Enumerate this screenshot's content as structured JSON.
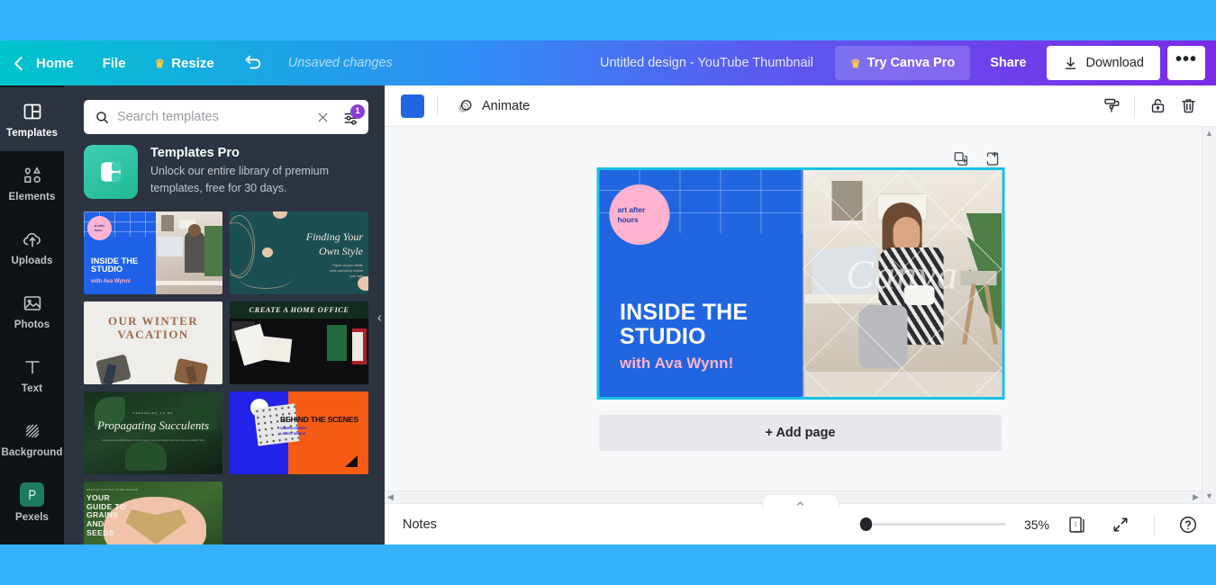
{
  "window": {
    "chrome_color": "#35B2FB"
  },
  "topbar": {
    "back_label": "Home",
    "file_label": "File",
    "resize_label": "Resize",
    "undo_icon": "undo-icon",
    "unsaved_label": "Unsaved changes",
    "doc_title": "Untitled design - YouTube Thumbnail",
    "try_pro_label": "Try Canva Pro",
    "share_label": "Share",
    "download_label": "Download",
    "more_label": "•••",
    "crown_icon": "crown-icon"
  },
  "rail": {
    "items": [
      {
        "label": "Templates",
        "icon": "templates-icon",
        "active": true
      },
      {
        "label": "Elements",
        "icon": "elements-icon",
        "active": false
      },
      {
        "label": "Uploads",
        "icon": "uploads-cloud-icon",
        "active": false
      },
      {
        "label": "Photos",
        "icon": "photos-image-icon",
        "active": false
      },
      {
        "label": "Text",
        "icon": "text-t-icon",
        "active": false
      },
      {
        "label": "Background",
        "icon": "background-hatch-icon",
        "active": false
      },
      {
        "label": "Pexels",
        "icon": "pexels-app-icon",
        "active": false
      }
    ]
  },
  "panel": {
    "search": {
      "placeholder": "Search templates",
      "value": "",
      "clear_icon": "close-icon",
      "filter_icon": "filter-sliders-icon",
      "filter_badge": "1"
    },
    "promo": {
      "title": "Templates Pro",
      "subtitle": "Unlock our entire library of premium templates, free for 30 days.",
      "icon": "templates-pro-icon"
    },
    "templates": [
      {
        "name": "Inside the Studio",
        "title": "INSIDE THE STUDIO",
        "subtitle": "with Ava Wynn!",
        "badge": "art after hours",
        "style": "studio"
      },
      {
        "name": "Finding Your Own Style",
        "title": "Finding Your Own Style",
        "subtitle": "Figure out your artistic voice and how to nurture your style",
        "style": "teal-organic"
      },
      {
        "name": "Our Winter Vacation",
        "title": "OUR WINTER VACATION",
        "style": "snow"
      },
      {
        "name": "Create a Home Office",
        "title": "CREATE A HOME OFFICE",
        "style": "desk"
      },
      {
        "name": "Propagating Succulents",
        "title": "Propagating Succulents",
        "subtitle": "PREPARING TO BE",
        "style": "succulents"
      },
      {
        "name": "Behind the Scenes",
        "title": "BEHIND THE SCENES",
        "subtitle": "SAMIRA HARDI'S LATEST SINGLE",
        "style": "orange"
      },
      {
        "name": "Your Guide to Grains and Seeds",
        "title": "YOUR GUIDE TO GRAINS AND SEEDS",
        "style": "grains"
      }
    ],
    "collapse_icon": "chevron-left-icon"
  },
  "editor": {
    "toolbar": {
      "color_swatch": "#2166E0",
      "animate_label": "Animate",
      "animate_icon": "animate-icon",
      "copy_style_icon": "paint-roller-icon",
      "lock_icon": "unlock-icon",
      "delete_icon": "trash-icon"
    },
    "page_tools": {
      "duplicate_icon": "duplicate-page-icon",
      "add_page_icon": "add-page-icon",
      "comment_icon": "add-comment-icon"
    },
    "design": {
      "badge_line1": "art after",
      "badge_line2": "hours",
      "heading_line1": "INSIDE THE",
      "heading_line2": "STUDIO",
      "subheading": "with Ava Wynn!",
      "watermark": "Canva",
      "bg_color": "#2166E0",
      "pink_color": "#FFB3D0",
      "selection_color": "#19C2E6"
    },
    "add_page_label": "+ Add page"
  },
  "statusbar": {
    "notes_label": "Notes",
    "notes_tab_icon": "chevron-up-icon",
    "zoom_value": "35%",
    "zoom_percent": 35,
    "page_indicator": "1",
    "page_indicator_icon": "pages-icon",
    "fullscreen_icon": "expand-icon",
    "help_icon": "help-circle-icon"
  }
}
